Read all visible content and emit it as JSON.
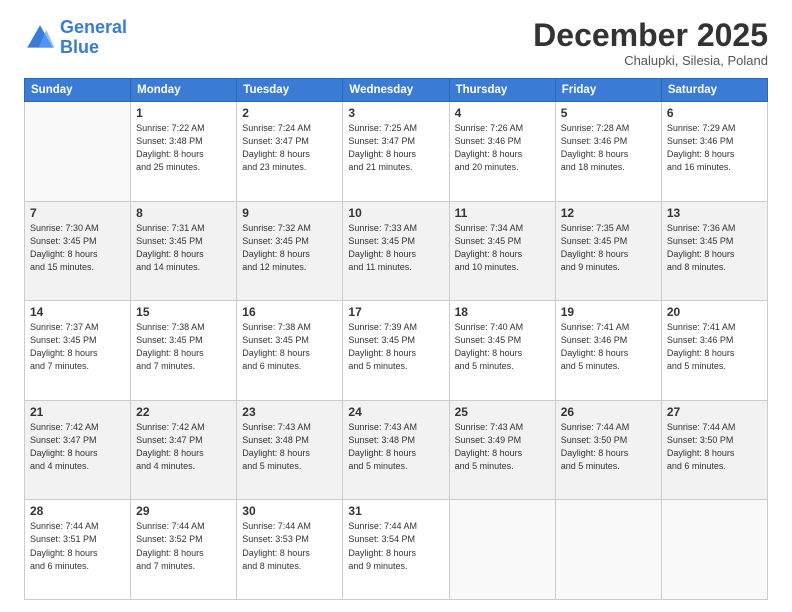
{
  "header": {
    "logo_line1": "General",
    "logo_line2": "Blue",
    "month": "December 2025",
    "location": "Chalupki, Silesia, Poland"
  },
  "weekdays": [
    "Sunday",
    "Monday",
    "Tuesday",
    "Wednesday",
    "Thursday",
    "Friday",
    "Saturday"
  ],
  "weeks": [
    [
      {
        "day": "",
        "info": ""
      },
      {
        "day": "1",
        "info": "Sunrise: 7:22 AM\nSunset: 3:48 PM\nDaylight: 8 hours\nand 25 minutes."
      },
      {
        "day": "2",
        "info": "Sunrise: 7:24 AM\nSunset: 3:47 PM\nDaylight: 8 hours\nand 23 minutes."
      },
      {
        "day": "3",
        "info": "Sunrise: 7:25 AM\nSunset: 3:47 PM\nDaylight: 8 hours\nand 21 minutes."
      },
      {
        "day": "4",
        "info": "Sunrise: 7:26 AM\nSunset: 3:46 PM\nDaylight: 8 hours\nand 20 minutes."
      },
      {
        "day": "5",
        "info": "Sunrise: 7:28 AM\nSunset: 3:46 PM\nDaylight: 8 hours\nand 18 minutes."
      },
      {
        "day": "6",
        "info": "Sunrise: 7:29 AM\nSunset: 3:46 PM\nDaylight: 8 hours\nand 16 minutes."
      }
    ],
    [
      {
        "day": "7",
        "info": "Sunrise: 7:30 AM\nSunset: 3:45 PM\nDaylight: 8 hours\nand 15 minutes."
      },
      {
        "day": "8",
        "info": "Sunrise: 7:31 AM\nSunset: 3:45 PM\nDaylight: 8 hours\nand 14 minutes."
      },
      {
        "day": "9",
        "info": "Sunrise: 7:32 AM\nSunset: 3:45 PM\nDaylight: 8 hours\nand 12 minutes."
      },
      {
        "day": "10",
        "info": "Sunrise: 7:33 AM\nSunset: 3:45 PM\nDaylight: 8 hours\nand 11 minutes."
      },
      {
        "day": "11",
        "info": "Sunrise: 7:34 AM\nSunset: 3:45 PM\nDaylight: 8 hours\nand 10 minutes."
      },
      {
        "day": "12",
        "info": "Sunrise: 7:35 AM\nSunset: 3:45 PM\nDaylight: 8 hours\nand 9 minutes."
      },
      {
        "day": "13",
        "info": "Sunrise: 7:36 AM\nSunset: 3:45 PM\nDaylight: 8 hours\nand 8 minutes."
      }
    ],
    [
      {
        "day": "14",
        "info": "Sunrise: 7:37 AM\nSunset: 3:45 PM\nDaylight: 8 hours\nand 7 minutes."
      },
      {
        "day": "15",
        "info": "Sunrise: 7:38 AM\nSunset: 3:45 PM\nDaylight: 8 hours\nand 7 minutes."
      },
      {
        "day": "16",
        "info": "Sunrise: 7:38 AM\nSunset: 3:45 PM\nDaylight: 8 hours\nand 6 minutes."
      },
      {
        "day": "17",
        "info": "Sunrise: 7:39 AM\nSunset: 3:45 PM\nDaylight: 8 hours\nand 5 minutes."
      },
      {
        "day": "18",
        "info": "Sunrise: 7:40 AM\nSunset: 3:45 PM\nDaylight: 8 hours\nand 5 minutes."
      },
      {
        "day": "19",
        "info": "Sunrise: 7:41 AM\nSunset: 3:46 PM\nDaylight: 8 hours\nand 5 minutes."
      },
      {
        "day": "20",
        "info": "Sunrise: 7:41 AM\nSunset: 3:46 PM\nDaylight: 8 hours\nand 5 minutes."
      }
    ],
    [
      {
        "day": "21",
        "info": "Sunrise: 7:42 AM\nSunset: 3:47 PM\nDaylight: 8 hours\nand 4 minutes."
      },
      {
        "day": "22",
        "info": "Sunrise: 7:42 AM\nSunset: 3:47 PM\nDaylight: 8 hours\nand 4 minutes."
      },
      {
        "day": "23",
        "info": "Sunrise: 7:43 AM\nSunset: 3:48 PM\nDaylight: 8 hours\nand 5 minutes."
      },
      {
        "day": "24",
        "info": "Sunrise: 7:43 AM\nSunset: 3:48 PM\nDaylight: 8 hours\nand 5 minutes."
      },
      {
        "day": "25",
        "info": "Sunrise: 7:43 AM\nSunset: 3:49 PM\nDaylight: 8 hours\nand 5 minutes."
      },
      {
        "day": "26",
        "info": "Sunrise: 7:44 AM\nSunset: 3:50 PM\nDaylight: 8 hours\nand 5 minutes."
      },
      {
        "day": "27",
        "info": "Sunrise: 7:44 AM\nSunset: 3:50 PM\nDaylight: 8 hours\nand 6 minutes."
      }
    ],
    [
      {
        "day": "28",
        "info": "Sunrise: 7:44 AM\nSunset: 3:51 PM\nDaylight: 8 hours\nand 6 minutes."
      },
      {
        "day": "29",
        "info": "Sunrise: 7:44 AM\nSunset: 3:52 PM\nDaylight: 8 hours\nand 7 minutes."
      },
      {
        "day": "30",
        "info": "Sunrise: 7:44 AM\nSunset: 3:53 PM\nDaylight: 8 hours\nand 8 minutes."
      },
      {
        "day": "31",
        "info": "Sunrise: 7:44 AM\nSunset: 3:54 PM\nDaylight: 8 hours\nand 9 minutes."
      },
      {
        "day": "",
        "info": ""
      },
      {
        "day": "",
        "info": ""
      },
      {
        "day": "",
        "info": ""
      }
    ]
  ]
}
